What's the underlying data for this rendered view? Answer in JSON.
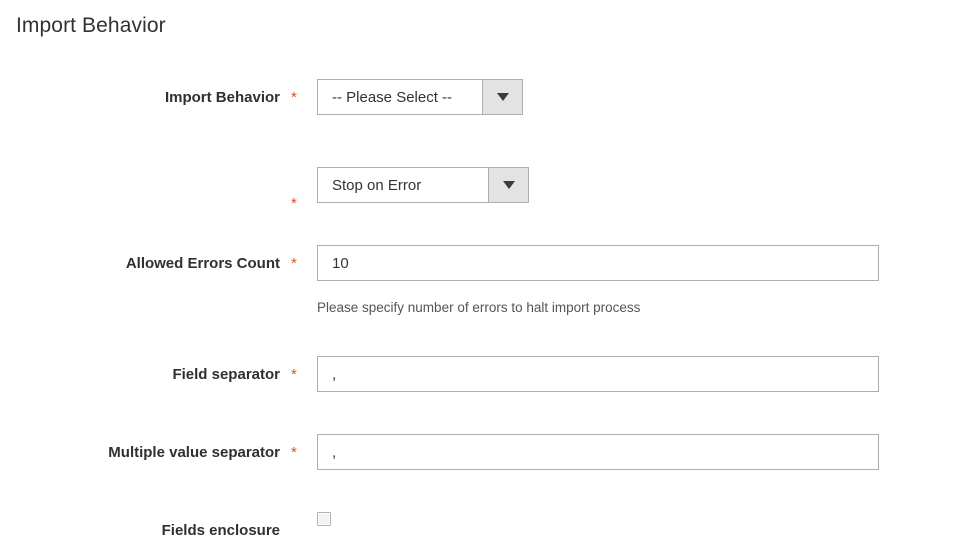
{
  "page": {
    "title": "Import Behavior",
    "required_marker": "*",
    "accent_required_color": "#e04f21",
    "text_color": "#303030",
    "heading_color": "#333333"
  },
  "form": {
    "fields": [
      {
        "name": "import-behavior",
        "label": "Import Behavior",
        "type": "select",
        "value": "-- Please Select --",
        "required": true,
        "arrow_icon": "chevron-down-icon"
      },
      {
        "name": "error-handling",
        "label": "",
        "type": "select",
        "value": "Stop on Error",
        "required": true,
        "arrow_icon": "chevron-down-icon"
      },
      {
        "name": "allowed-errors-count",
        "label": "Allowed Errors Count",
        "type": "text",
        "value": "10",
        "required": true,
        "note": "Please specify number of errors to halt import process"
      },
      {
        "name": "field-separator",
        "label": "Field separator",
        "type": "text",
        "value": ",",
        "required": true
      },
      {
        "name": "multiple-value-separator",
        "label": "Multiple value separator",
        "type": "text",
        "value": ",",
        "required": true
      },
      {
        "name": "fields-enclosure",
        "label": "Fields enclosure",
        "type": "checkbox",
        "checked": false,
        "required": false
      }
    ]
  }
}
